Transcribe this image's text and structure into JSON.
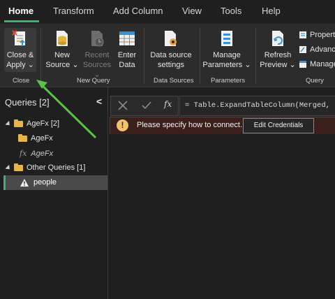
{
  "menu": {
    "tabs": [
      "Home",
      "Transform",
      "Add Column",
      "View",
      "Tools",
      "Help"
    ],
    "accent": "#3cb371"
  },
  "ribbon": {
    "close_apply": {
      "line1": "Close &",
      "line2": "Apply",
      "caret": "⌄"
    },
    "new_source": {
      "line1": "New",
      "line2": "Source",
      "caret": "⌄"
    },
    "recent_sources": {
      "line1": "Recent",
      "line2": "Sources",
      "caret": "⌄"
    },
    "enter_data": {
      "line1": "Enter",
      "line2": "Data"
    },
    "data_source_settings": {
      "line1": "Data source",
      "line2": "settings"
    },
    "manage_parameters": {
      "line1": "Manage",
      "line2": "Parameters",
      "caret": "⌄"
    },
    "refresh_preview": {
      "line1": "Refresh",
      "line2": "Preview",
      "caret": "⌄"
    },
    "properties": "Propert",
    "advanced": "Advanc",
    "manage": "Manage",
    "groups": {
      "close": "Close",
      "new_query": "New Query",
      "data_sources": "Data Sources",
      "parameters": "Parameters",
      "query": "Query"
    }
  },
  "queries_pane": {
    "title": "Queries [2]",
    "collapse_glyph": "<",
    "items": [
      {
        "label": "AgeFx [2]"
      },
      {
        "label": "AgeFx"
      },
      {
        "label": "AgeFx"
      },
      {
        "label": "Other Queries [1]"
      },
      {
        "label": "people"
      }
    ]
  },
  "formula": {
    "fx": "fx",
    "text": "= Table.ExpandTableColumn(Merged, \"A"
  },
  "warning": {
    "message": "Please specify how to connect.",
    "button": "Edit Credentials",
    "icon_glyph": "!"
  },
  "colors": {
    "warning_bg": "#3b1f1a",
    "folder": "#e6b44c",
    "annotation_arrow": "#5cc247"
  }
}
